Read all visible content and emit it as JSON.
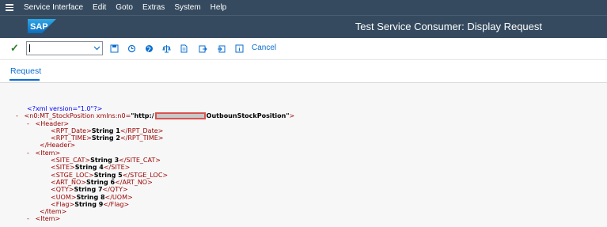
{
  "menubar": {
    "items": [
      {
        "label": "Service Interface"
      },
      {
        "label": "Edit"
      },
      {
        "label": "Goto"
      },
      {
        "label": "Extras"
      },
      {
        "label": "System"
      },
      {
        "label": "Help"
      }
    ]
  },
  "header": {
    "logo_text": "SAP",
    "title": "Test Service Consumer: Display Request"
  },
  "toolbar": {
    "command_value": "",
    "cancel_label": "Cancel"
  },
  "tabs": {
    "request_label": "Request"
  },
  "xml": {
    "pi": "<?xml version=\"1.0\"?>",
    "root_open_prefix": "<n0:MT_StockPosition xmlns:n0=",
    "root_url_start": "\"http:/",
    "root_url_end": "OutbounStockPosition\"",
    "root_close_bracket": ">",
    "header_open": "<Header>",
    "rpt_date_open": "<RPT_Date>",
    "rpt_date_val": "String 1",
    "rpt_date_close": "</RPT_Date>",
    "rpt_time_open": "<RPT_TIME>",
    "rpt_time_val": "String 2",
    "rpt_time_close": "</RPT_TIME>",
    "header_close": "</Header>",
    "item_open": "<Item>",
    "site_cat_open": "<SITE_CAT>",
    "site_cat_val": "String 3",
    "site_cat_close": "</SITE_CAT>",
    "site_open": "<SITE>",
    "site_val": "String 4",
    "site_close": "</SITE>",
    "stge_loc_open": "<STGE_LOC>",
    "stge_loc_val": "String 5",
    "stge_loc_close": "</STGE_LOC>",
    "art_no_open": "<ART_NO>",
    "art_no_val": "String 6",
    "art_no_close": "</ART_NO>",
    "qty_open": "<QTY>",
    "qty_val": "String 7",
    "qty_close": "</QTY>",
    "uom_open": "<UOM>",
    "uom_val": "String 8",
    "uom_close": "</UOM>",
    "flag_open": "<Flag>",
    "flag_val": "String 9",
    "flag_close": "</Flag>",
    "item_close": "</Item>",
    "toggle": "-"
  },
  "colors": {
    "shell": "#354a5f",
    "accent": "#0a6ed1",
    "tag": "#990000",
    "highlight_border": "#d9534f"
  }
}
